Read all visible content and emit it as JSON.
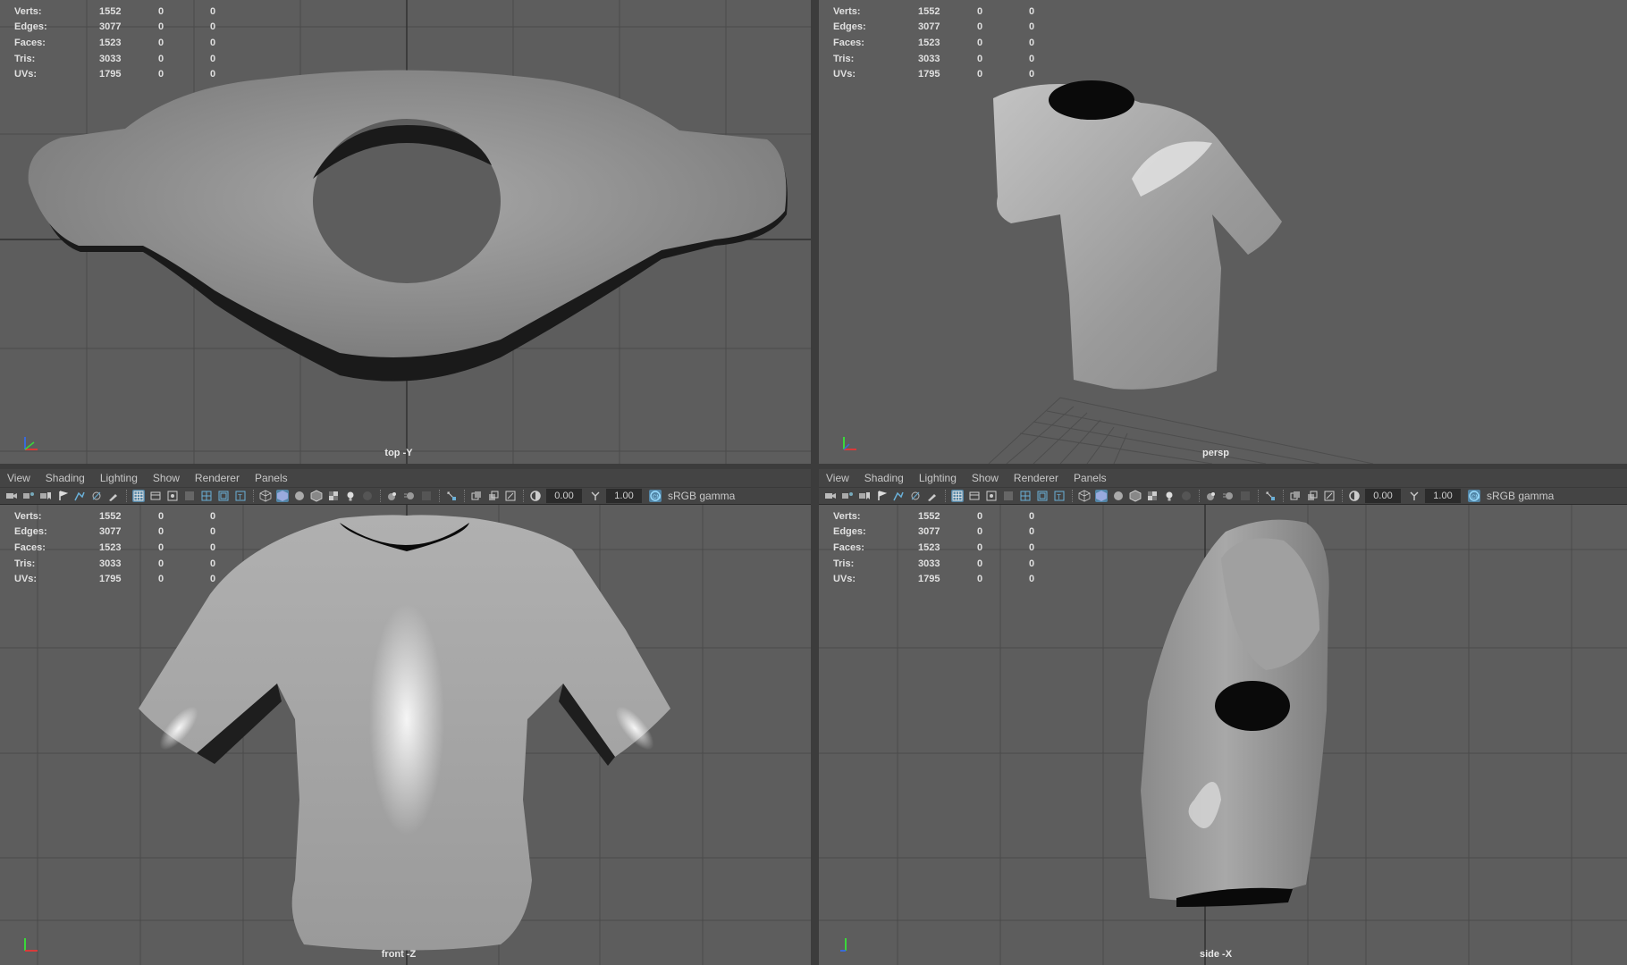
{
  "hud": {
    "rows": [
      {
        "label": "Verts:",
        "v1": "1552",
        "v2": "0",
        "v3": "0"
      },
      {
        "label": "Edges:",
        "v1": "3077",
        "v2": "0",
        "v3": "0"
      },
      {
        "label": "Faces:",
        "v1": "1523",
        "v2": "0",
        "v3": "0"
      },
      {
        "label": "Tris:",
        "v1": "3033",
        "v2": "0",
        "v3": "0"
      },
      {
        "label": "UVs:",
        "v1": "1795",
        "v2": "0",
        "v3": "0"
      }
    ]
  },
  "viewports": {
    "top": {
      "camera": "top -Y"
    },
    "persp": {
      "camera": "persp"
    },
    "front": {
      "camera": "front -Z"
    },
    "side": {
      "camera": "side -X"
    }
  },
  "panel_menu": {
    "view": "View",
    "shading": "Shading",
    "lighting": "Lighting",
    "show": "Show",
    "renderer": "Renderer",
    "panels": "Panels"
  },
  "panel_toolbar": {
    "exposure": "0.00",
    "gamma": "1.00",
    "color_space": "sRGB gamma"
  },
  "colors": {
    "viewport_bg": "#5d5d5d",
    "grid": "#4a4a4a",
    "ui_bg": "#444444",
    "highlight": "#5285a6"
  },
  "icons": [
    "camera-icon",
    "bookmark-icon",
    "grid-icon",
    "wireframe-icon",
    "smooth-shade-icon",
    "texture-icon",
    "light-icon",
    "shadow-icon",
    "isolate-icon",
    "xray-icon",
    "exposure-icon",
    "gamma-icon",
    "color-management-icon"
  ]
}
